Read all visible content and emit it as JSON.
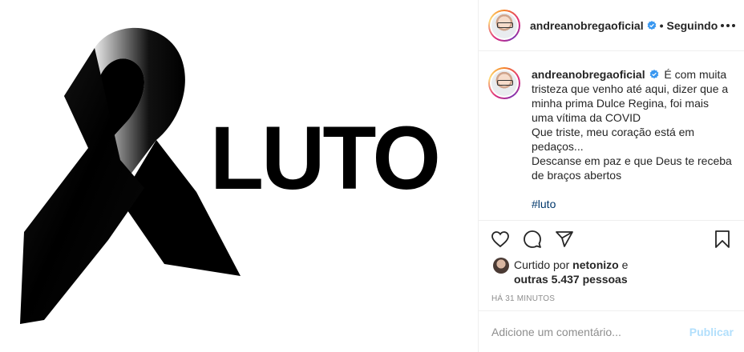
{
  "media": {
    "overlay_text": "LUTO"
  },
  "header": {
    "username": "andreanobregaoficial",
    "separator": "•",
    "follow_status": "Seguindo"
  },
  "caption": {
    "username": "andreanobregaoficial",
    "lines": [
      "É com muita tristeza que venho até aqui, dizer que a minha prima Dulce Regina, foi mais uma vítima da COVID",
      "Que triste, meu coração está em pedaços...",
      "Descanse em paz e que Deus te receba de braços abertos"
    ],
    "hashtag": "#luto"
  },
  "likes": {
    "prefix": "Curtido por",
    "liker": "netonizo",
    "conjunction": "e",
    "others": "outras 5.437 pessoas"
  },
  "timestamp": "Há 31 minutos",
  "comment": {
    "placeholder": "Adicione um comentário...",
    "publish_label": "Publicar"
  },
  "colors": {
    "verified": "#3897f0",
    "hashtag": "#00376b",
    "publish_disabled": "#b2dffc",
    "muted": "#8e8e8e"
  },
  "icons": [
    "more-options-icon",
    "verified-badge-icon",
    "heart-icon",
    "comment-icon",
    "share-icon",
    "bookmark-icon"
  ]
}
